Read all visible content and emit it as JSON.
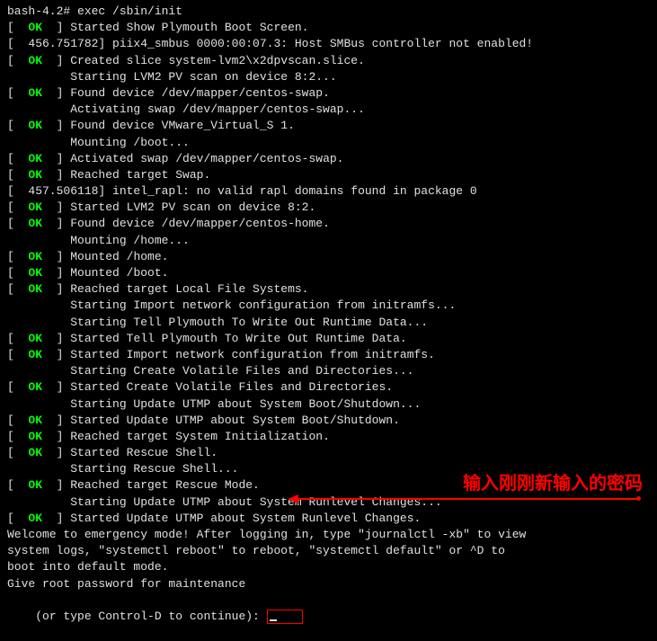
{
  "prompt_line": "bash-4.2# exec /sbin/init",
  "ok_label": "OK",
  "lines": [
    {
      "type": "ok",
      "text": "] Started Show Plymouth Boot Screen."
    },
    {
      "type": "plain",
      "text": "[  456.751782] piix4_smbus 0000:00:07.3: Host SMBus controller not enabled!"
    },
    {
      "type": "ok",
      "text": "] Created slice system-lvm2\\x2dpvscan.slice."
    },
    {
      "type": "indent",
      "text": "Starting LVM2 PV scan on device 8:2..."
    },
    {
      "type": "ok",
      "text": "] Found device /dev/mapper/centos-swap."
    },
    {
      "type": "indent",
      "text": "Activating swap /dev/mapper/centos-swap..."
    },
    {
      "type": "ok",
      "text": "] Found device VMware_Virtual_S 1."
    },
    {
      "type": "indent",
      "text": "Mounting /boot..."
    },
    {
      "type": "ok",
      "text": "] Activated swap /dev/mapper/centos-swap."
    },
    {
      "type": "ok",
      "text": "] Reached target Swap."
    },
    {
      "type": "plain",
      "text": "[  457.506118] intel_rapl: no valid rapl domains found in package 0"
    },
    {
      "type": "ok",
      "text": "] Started LVM2 PV scan on device 8:2."
    },
    {
      "type": "ok",
      "text": "] Found device /dev/mapper/centos-home."
    },
    {
      "type": "indent",
      "text": "Mounting /home..."
    },
    {
      "type": "ok",
      "text": "] Mounted /home."
    },
    {
      "type": "ok",
      "text": "] Mounted /boot."
    },
    {
      "type": "ok",
      "text": "] Reached target Local File Systems."
    },
    {
      "type": "indent",
      "text": "Starting Import network configuration from initramfs..."
    },
    {
      "type": "indent",
      "text": "Starting Tell Plymouth To Write Out Runtime Data..."
    },
    {
      "type": "ok",
      "text": "] Started Tell Plymouth To Write Out Runtime Data."
    },
    {
      "type": "ok",
      "text": "] Started Import network configuration from initramfs."
    },
    {
      "type": "indent",
      "text": "Starting Create Volatile Files and Directories..."
    },
    {
      "type": "ok",
      "text": "] Started Create Volatile Files and Directories."
    },
    {
      "type": "indent",
      "text": "Starting Update UTMP about System Boot/Shutdown..."
    },
    {
      "type": "ok",
      "text": "] Started Update UTMP about System Boot/Shutdown."
    },
    {
      "type": "ok",
      "text": "] Reached target System Initialization."
    },
    {
      "type": "ok",
      "text": "] Started Rescue Shell."
    },
    {
      "type": "indent",
      "text": "Starting Rescue Shell..."
    },
    {
      "type": "ok",
      "text": "] Reached target Rescue Mode."
    },
    {
      "type": "indent",
      "text": "Starting Update UTMP about System Runlevel Changes..."
    },
    {
      "type": "ok",
      "text": "] Started Update UTMP about System Runlevel Changes."
    },
    {
      "type": "plain",
      "text": "Welcome to emergency mode! After logging in, type \"journalctl -xb\" to view"
    },
    {
      "type": "plain",
      "text": "system logs, \"systemctl reboot\" to reboot, \"systemctl default\" or ^D to"
    },
    {
      "type": "plain",
      "text": "boot into default mode."
    },
    {
      "type": "plain",
      "text": "Give root password for maintenance"
    }
  ],
  "final_prompt": "(or type Control-D to continue): ",
  "annotation_text": "输入刚刚新输入的密码"
}
